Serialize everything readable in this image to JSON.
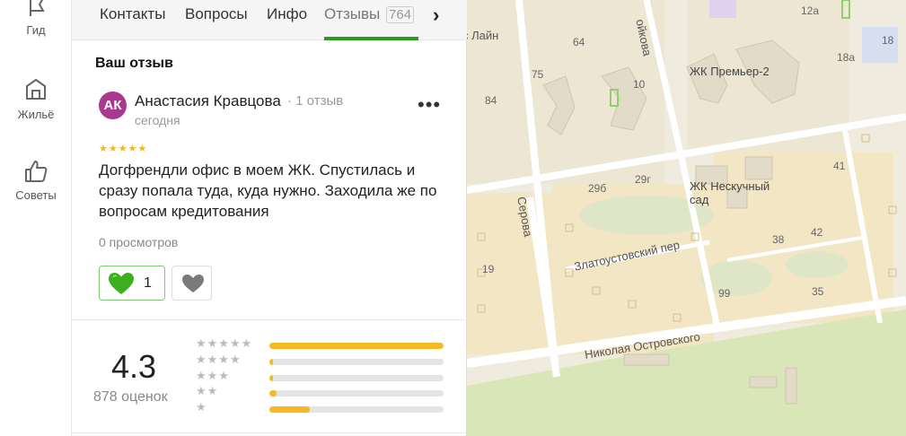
{
  "rail": {
    "items": [
      {
        "label": "Гид",
        "icon": "flag-icon"
      },
      {
        "label": "Жильё",
        "icon": "house-icon"
      },
      {
        "label": "Советы",
        "icon": "thumbs-up-icon"
      }
    ]
  },
  "tabs": {
    "items": [
      "Контакты",
      "Вопросы",
      "Инфо",
      "Отзывы"
    ],
    "reviews_count": "764",
    "next_icon": "chevron-right-icon"
  },
  "review": {
    "heading": "Ваш отзыв",
    "avatar_initials": "АК",
    "author": "Анастасия Кравцова",
    "author_reviews": "1 отзыв",
    "date": "сегодня",
    "stars": "★★★★★",
    "rating": 5,
    "text": "Догфрендли офис в моем ЖК. Спустилась и сразу попала туда, куда нужно. Заходила же по вопросам кредитования",
    "views": "0 просмотров",
    "likes": "1",
    "more_icon": "more-dots-icon",
    "colors": {
      "avatar": "#a8398f",
      "like_border": "#7acc6e",
      "heart": "#3cb01e",
      "accent": "#2a9a1e"
    }
  },
  "summary": {
    "rating": "4.3",
    "count": "878 оценок",
    "distribution": [
      {
        "stars": "★★★★★",
        "fraction": 1.0
      },
      {
        "stars": "★★★★",
        "fraction": 0.02
      },
      {
        "stars": "★★★",
        "fraction": 0.02
      },
      {
        "stars": "★★",
        "fraction": 0.04
      },
      {
        "stars": "★",
        "fraction": 0.23
      }
    ],
    "bar_color": "#f7b822"
  },
  "map": {
    "streets": [
      "Серова",
      "Златоустовский пер",
      "Николая Островского",
      "с Лайн",
      "ойкова"
    ],
    "places": [
      "ЖК Премьер-2",
      "ЖК Нескучный сад"
    ],
    "house_numbers": [
      "12а",
      "18",
      "18а",
      "64",
      "75",
      "10",
      "84",
      "41",
      "29б",
      "29г",
      "38",
      "42",
      "19",
      "99",
      "35"
    ]
  }
}
